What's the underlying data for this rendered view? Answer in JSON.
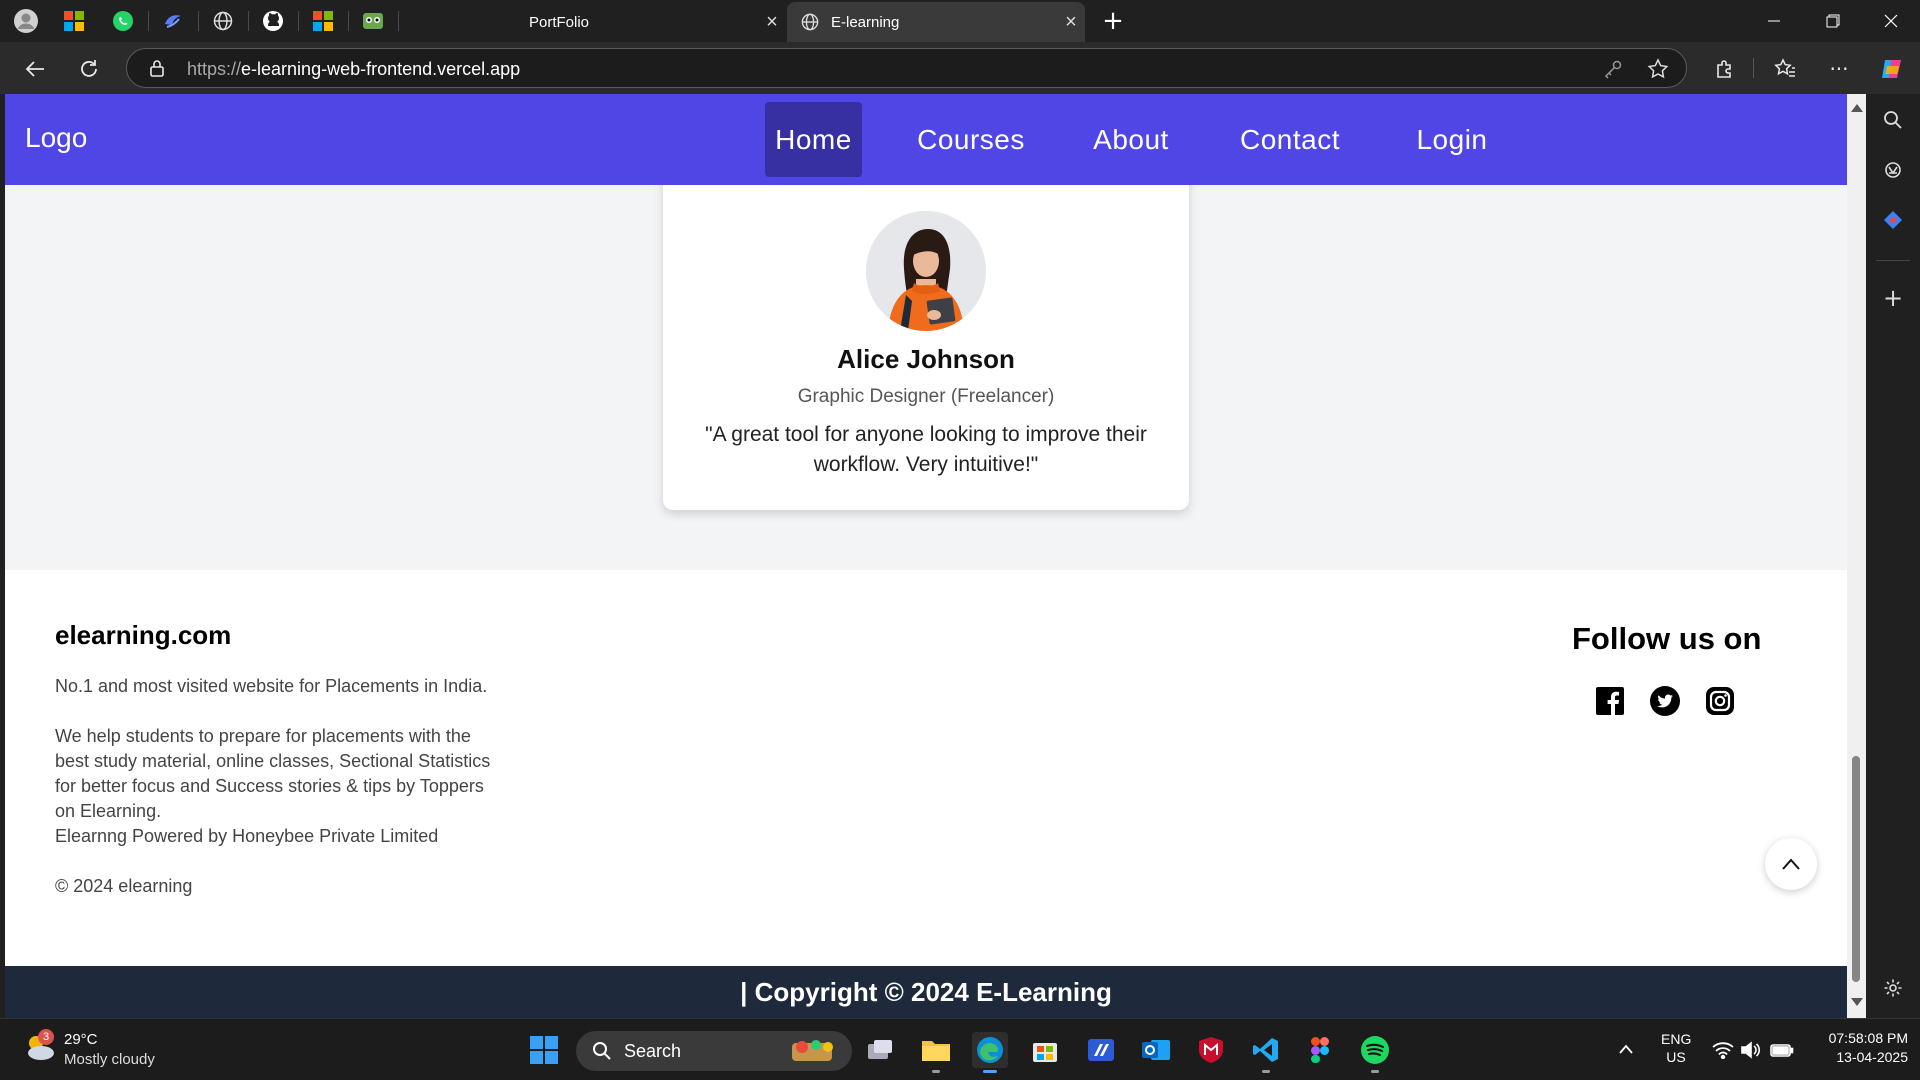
{
  "browser": {
    "tabs": [
      {
        "label": "PortFolio",
        "active": false
      },
      {
        "label": "E-learning",
        "active": true
      }
    ],
    "url_protocol": "https://",
    "url_host": "e-learning-web-frontend.vercel.app"
  },
  "navbar": {
    "logo": "Logo",
    "links": [
      "Home",
      "Courses",
      "About",
      "Contact",
      "Login"
    ],
    "active": "Home",
    "color": "#4f46e5"
  },
  "testimonial": {
    "name": "Alice Johnson",
    "role": "Graphic Designer (Freelancer)",
    "quote": "\"A great tool for anyone looking to improve their workflow. Very intuitive!\""
  },
  "footer": {
    "brand": "elearning.com",
    "p1": "No.1 and most visited website for Placements in India.",
    "p2": "We help students to prepare for placements with the best study material, online classes, Sectional Statistics for better focus and Success stories & tips by Toppers on Elearning.",
    "p3": "Elearnng Powered by Honeybee Private Limited",
    "copyright_small": "© 2024 elearning",
    "follow": "Follow us on",
    "social_icons": [
      "facebook-icon",
      "twitter-icon",
      "instagram-icon"
    ],
    "copyright_bar": "| Copyright © 2024 E-Learning"
  },
  "taskbar": {
    "weather_temp": "29°C",
    "weather_desc": "Mostly cloudy",
    "weather_badge": "3",
    "search": "Search",
    "lang1": "ENG",
    "lang2": "US",
    "time": "07:58:08 PM",
    "date": "13-04-2025"
  }
}
